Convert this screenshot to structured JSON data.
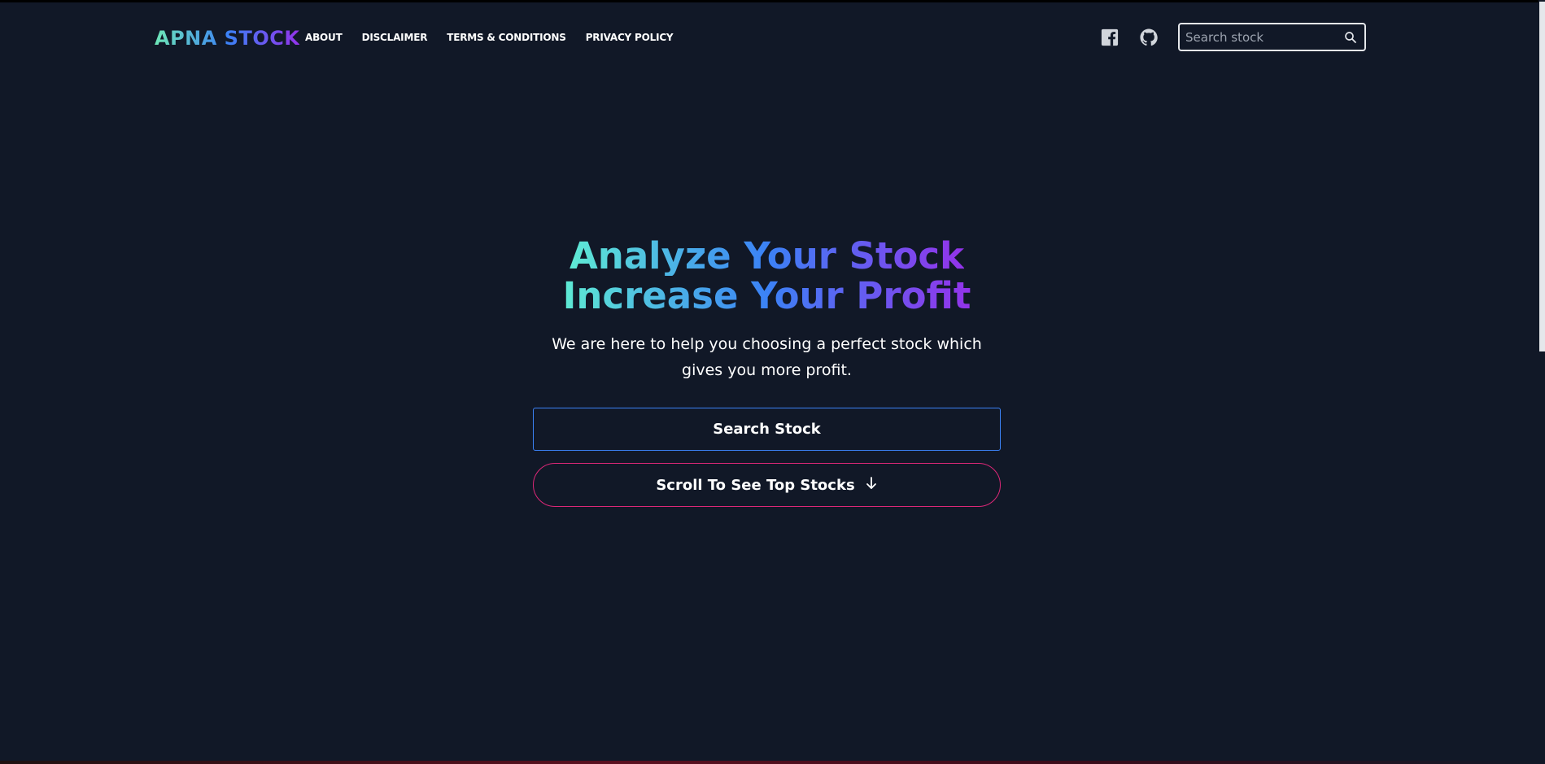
{
  "brand": {
    "name": "APNA STOCK"
  },
  "nav": {
    "links": [
      {
        "label": "ABOUT"
      },
      {
        "label": "DISCLAIMER"
      },
      {
        "label": "TERMS & CONDITIONS"
      },
      {
        "label": "PRIVACY POLICY"
      }
    ]
  },
  "social": {
    "icons": [
      "facebook-icon",
      "github-icon"
    ]
  },
  "search": {
    "placeholder": "Search stock",
    "icon": "search-icon"
  },
  "hero": {
    "title_line1": "Analyze Your Stock",
    "title_line2": "Increase Your Profit",
    "subtitle": "We are here to help you choosing a perfect stock which gives you more profit.",
    "search_button": "Search Stock",
    "scroll_button": "Scroll To See Top Stocks",
    "scroll_icon": "arrow-down-icon"
  },
  "colors": {
    "background": "#111827",
    "gradient_start": "#5eead4",
    "gradient_mid": "#3b82f6",
    "gradient_end": "#9333ea",
    "search_button_border": "#3b82f6",
    "scroll_button_border": "#db2777",
    "text": "#ffffff"
  }
}
